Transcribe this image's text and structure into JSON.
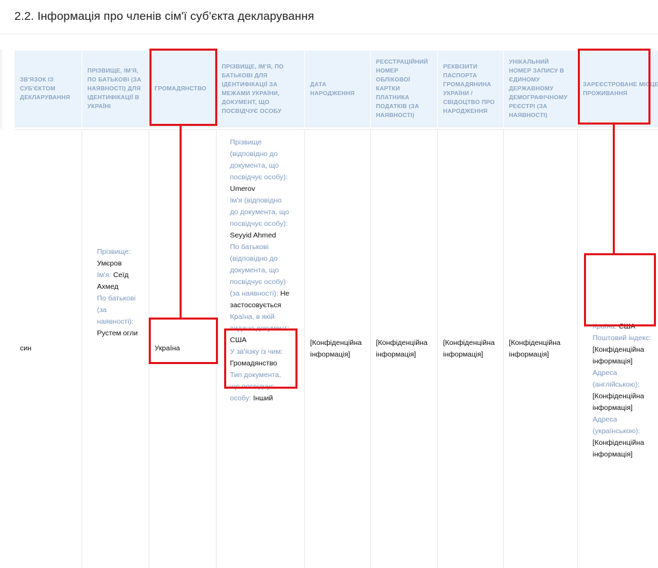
{
  "section_title": "2.2. Інформація про членів сім'ї суб'єкта декларування",
  "columns": [
    "Зв'язок із суб'єктом декларування",
    "Прізвище, ім'я, по батькові (за наявності) для ідентифікації в Україні",
    "Громадянство",
    "Прізвище, ім'я, по батькові для ідентифікації за межами України, документ, що посвідчує особу",
    "Дата народження",
    "Реєстраційний номер облікової картки платника податків (за наявності)",
    "Реквізити паспорта громадянина України / свідоцтво про народження",
    "Унікальний номер запису в Єдиному державному демографічному реєстрі (за наявності)",
    "Зареєстроване місце проживання"
  ],
  "row": {
    "relation": "син",
    "name_ua": {
      "surname_label": "Прізвище:",
      "surname": "Умєров",
      "name_label": "Ім'я:",
      "name": "Сеїд Ахмед",
      "patronymic_label": "По батькові (за наявності):",
      "patronymic": "Рустем огли"
    },
    "citizenship": "Україна",
    "foreign_id": {
      "surname_label": "Прізвище (відповідно до документа, що посвідчує особу):",
      "surname": "Umerov",
      "name_label": "Ім'я (відповідно до документа, що посвідчує особу):",
      "name": "Seyyid Ahmed",
      "patronymic_label": "По батькові (відповідно до документа, що посвідчує особу) (за наявності):",
      "patronymic": "Не застосовується",
      "country_label": "Країна, в якій видано документ:",
      "country": "США",
      "reason_label": "У зв'язку із чим:",
      "reason": "Громадянство",
      "doc_type_label": "Тип документа, що посвідчує особу:",
      "doc_type": "Інший"
    },
    "birth_date": "[Конфіденційна інформація]",
    "tax_number": "[Конфіденційна інформація]",
    "passport": "[Конфіденційна інформація]",
    "demographic_record": "[Конфіденційна інформація]",
    "residence": {
      "country_label": "Країна:",
      "country": "США",
      "postal_label": "Поштовий індекс:",
      "postal": "[Конфіденційна інформація]",
      "address_en_label": "Адреса (англійською):",
      "address_en": "[Конфіденційна інформація]",
      "address_ua_label": "Адреса (українською):",
      "address_ua": "[Конфіденційна інформація]"
    }
  },
  "colors": {
    "annotation": "#e3141c",
    "header_bg": "#eaf3fb",
    "header_text": "#8da6c4",
    "label_text": "#7b9ac0"
  }
}
